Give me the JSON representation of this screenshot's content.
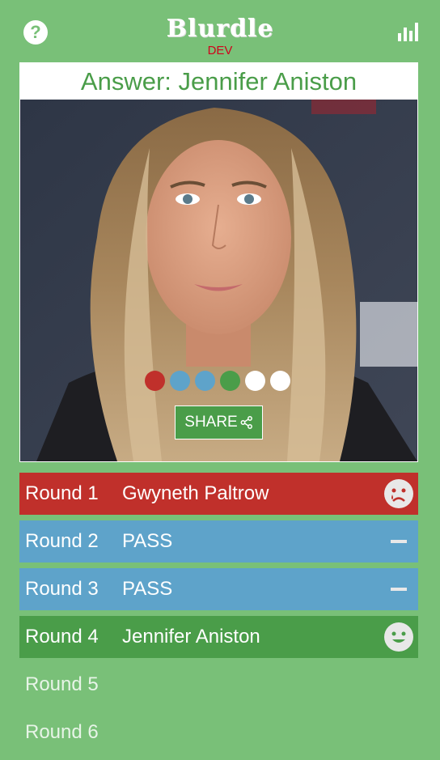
{
  "header": {
    "help_icon": "question-icon",
    "help_label": "?",
    "logo": "Blurdle",
    "logo_sub": "DEV",
    "stats_icon": "bar-chart-icon"
  },
  "answer": {
    "text": "Answer: Jennifer Aniston"
  },
  "progress_dots": [
    "#c0302b",
    "#5ea3ca",
    "#5ea3ca",
    "#4a9d49",
    "#ffffff",
    "#ffffff"
  ],
  "share": {
    "label": "SHARE",
    "icon": "share-icon"
  },
  "rounds": [
    {
      "label": "Round 1",
      "guess": "Gwyneth Paltrow",
      "status": "wrong",
      "color": "#c0302b",
      "icon": "sad-face-icon"
    },
    {
      "label": "Round 2",
      "guess": "PASS",
      "status": "pass",
      "color": "#5ea3ca",
      "icon": "dash-icon"
    },
    {
      "label": "Round 3",
      "guess": "PASS",
      "status": "pass",
      "color": "#5ea3ca",
      "icon": "dash-icon"
    },
    {
      "label": "Round 4",
      "guess": "Jennifer Aniston",
      "status": "correct",
      "color": "#4a9d49",
      "icon": "happy-face-icon"
    },
    {
      "label": "Round 5",
      "guess": "",
      "status": "empty",
      "color": "",
      "icon": ""
    },
    {
      "label": "Round 6",
      "guess": "",
      "status": "empty",
      "color": "",
      "icon": ""
    }
  ],
  "colors": {
    "background": "#79c078",
    "accent": "#4a9d49",
    "wrong": "#c0302b",
    "pass": "#5ea3ca"
  }
}
